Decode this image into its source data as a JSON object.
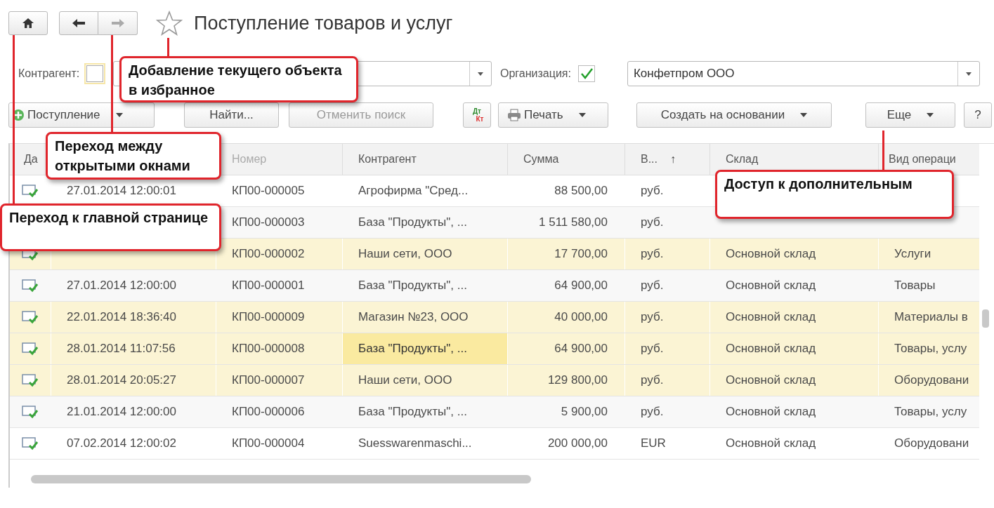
{
  "title": "Поступление товаров и услуг",
  "favorite": {
    "selected": false
  },
  "filters": [
    {
      "label": "Контрагент:",
      "checked": false
    },
    {
      "label": "Организация:",
      "checked": true,
      "value": "Конфетпром ООО"
    }
  ],
  "commands": [
    {
      "kind": "add",
      "label": "Поступление",
      "dropdown": true,
      "disabled": false
    },
    {
      "kind": "plain",
      "label": "Найти...",
      "dropdown": false,
      "disabled": false
    },
    {
      "kind": "plain",
      "label": "Отменить поиск",
      "dropdown": false,
      "disabled": true
    },
    {
      "kind": "accounting",
      "top": "Дт",
      "bottom": "Кт",
      "dropdown": false,
      "disabled": false
    },
    {
      "kind": "print",
      "label": "Печать",
      "dropdown": true,
      "disabled": false
    },
    {
      "kind": "plain",
      "label": "Создать на основании",
      "dropdown": true,
      "disabled": false
    },
    {
      "kind": "plain",
      "label": "Еще",
      "dropdown": true,
      "disabled": false
    },
    {
      "kind": "plain",
      "label": "?",
      "dropdown": false,
      "disabled": false
    }
  ],
  "table": {
    "columns": [
      {
        "label": "Да"
      },
      {
        "label": "Номер"
      },
      {
        "label": "Контрагент"
      },
      {
        "label": "Сумма"
      },
      {
        "label": "В...",
        "sort_mark": "↑"
      },
      {
        "label": "Склад"
      },
      {
        "label": "Вид операци"
      }
    ],
    "rows": [
      {
        "posted": true,
        "highlighted": false,
        "selected": false,
        "cells": [
          "27.01.2014 12:00:01",
          "КП00-000005",
          "Агрофирма \"Сред...",
          "88 500,00",
          "руб.",
          null,
          null
        ]
      },
      {
        "highlighted": false,
        "selected": false,
        "cells": [
          null,
          "КП00-000003",
          "База \"Продукты\", ...",
          "1 511 580,00",
          "руб.",
          null,
          null
        ]
      },
      {
        "posted": true,
        "highlighted": true,
        "selected": false,
        "cells": [
          null,
          "КП00-000002",
          "Наши сети, ООО",
          "17 700,00",
          "руб.",
          "Основной склад",
          "Услуги"
        ]
      },
      {
        "posted": true,
        "highlighted": false,
        "selected": false,
        "cells": [
          "27.01.2014 12:00:00",
          "КП00-000001",
          "База \"Продукты\", ...",
          "64 900,00",
          "руб.",
          "Основной склад",
          "Товары"
        ]
      },
      {
        "posted": true,
        "highlighted": true,
        "selected": false,
        "cells": [
          "22.01.2014 18:36:40",
          "КП00-000009",
          "Магазин №23, ООО",
          "40 000,00",
          "руб.",
          "Основной склад",
          "Материалы в"
        ]
      },
      {
        "posted": true,
        "highlighted": true,
        "selected": true,
        "cells": [
          "28.01.2014 11:07:56",
          "КП00-000008",
          "База \"Продукты\", ...",
          "64 900,00",
          "руб.",
          "Основной склад",
          "Товары, услу"
        ]
      },
      {
        "posted": true,
        "highlighted": true,
        "selected": false,
        "cells": [
          "28.01.2014 20:05:27",
          "КП00-000007",
          "Наши сети, ООО",
          "129 800,00",
          "руб.",
          "Основной склад",
          "Оборудовани"
        ]
      },
      {
        "posted": true,
        "highlighted": false,
        "selected": false,
        "cells": [
          "21.01.2014 12:00:00",
          "КП00-000006",
          "База \"Продукты\", ...",
          "5 900,00",
          "руб.",
          "Основной склад",
          "Товары, услу"
        ]
      },
      {
        "posted": true,
        "highlighted": false,
        "selected": false,
        "cells": [
          "07.02.2014 12:00:02",
          "КП00-000004",
          "Suesswarenmaschi...",
          "200 000,00",
          "EUR",
          "Основной склад",
          "Оборудовани"
        ]
      }
    ]
  },
  "callouts": [
    {
      "text": "Добавление текущего объекта в избранное"
    },
    {
      "text": "Переход между открытыми окнами"
    },
    {
      "text": "Переход к главной странице"
    },
    {
      "text": "Доступ к дополнительным"
    }
  ]
}
